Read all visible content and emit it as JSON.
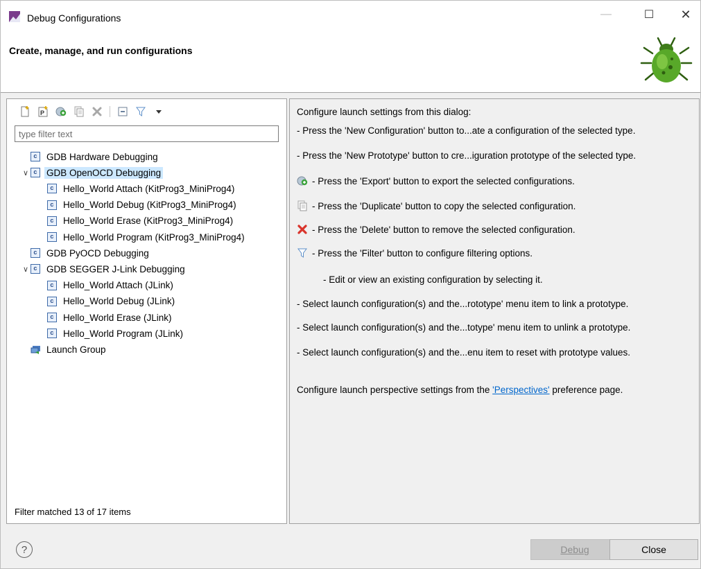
{
  "window": {
    "title": "Debug Configurations",
    "minimize_glyph": "—",
    "maximize_glyph": "☐",
    "close_glyph": "✕"
  },
  "header": {
    "title": "Create, manage, and run configurations"
  },
  "left": {
    "filter_placeholder": "type filter text",
    "status": "Filter matched 13 of 17 items",
    "tree": [
      {
        "label": "GDB Hardware Debugging",
        "icon": "c-config-icon",
        "level": 1,
        "expandable": false
      },
      {
        "label": "GDB OpenOCD Debugging",
        "icon": "c-config-icon",
        "level": 1,
        "expandable": true,
        "expanded": true,
        "selected": true
      },
      {
        "label": "Hello_World Attach (KitProg3_MiniProg4)",
        "icon": "c-config-icon",
        "level": 2
      },
      {
        "label": "Hello_World Debug (KitProg3_MiniProg4)",
        "icon": "c-config-icon",
        "level": 2
      },
      {
        "label": "Hello_World Erase (KitProg3_MiniProg4)",
        "icon": "c-config-icon",
        "level": 2
      },
      {
        "label": "Hello_World Program (KitProg3_MiniProg4)",
        "icon": "c-config-icon",
        "level": 2
      },
      {
        "label": "GDB PyOCD Debugging",
        "icon": "c-config-icon",
        "level": 1,
        "expandable": false
      },
      {
        "label": "GDB SEGGER J-Link Debugging",
        "icon": "c-config-icon",
        "level": 1,
        "expandable": true,
        "expanded": true
      },
      {
        "label": "Hello_World Attach (JLink)",
        "icon": "c-config-icon",
        "level": 2
      },
      {
        "label": "Hello_World Debug (JLink)",
        "icon": "c-config-icon",
        "level": 2
      },
      {
        "label": "Hello_World Erase (JLink)",
        "icon": "c-config-icon",
        "level": 2
      },
      {
        "label": "Hello_World Program (JLink)",
        "icon": "c-config-icon",
        "level": 2
      },
      {
        "label": "Launch Group",
        "icon": "launch-group-icon",
        "level": 1,
        "expandable": false
      }
    ]
  },
  "right": {
    "intro": "Configure launch settings from this dialog:",
    "lines": [
      {
        "text": "- Press the 'New Configuration' button to...ate a configuration of the selected type.",
        "icon": null
      },
      {
        "text": "- Press the 'New Prototype' button to cre...iguration prototype of the selected type.",
        "icon": null
      },
      {
        "text": "- Press the 'Export' button to export the selected configurations.",
        "icon": "export-icon"
      },
      {
        "text": "- Press the 'Duplicate' button to copy the selected configuration.",
        "icon": "duplicate-icon"
      },
      {
        "text": "- Press the 'Delete' button to remove the selected configuration.",
        "icon": "delete-icon"
      },
      {
        "text": "- Press the 'Filter' button to configure filtering options.",
        "icon": "filter-icon"
      },
      {
        "text": "- Edit or view an existing configuration by selecting it.",
        "icon": "blank"
      },
      {
        "text": "- Select launch configuration(s) and the...rototype' menu item to link a prototype.",
        "icon": null
      },
      {
        "text": "- Select launch configuration(s) and the...totype' menu item to unlink a prototype.",
        "icon": null
      },
      {
        "text": "- Select launch configuration(s) and the...enu item to reset with prototype values.",
        "icon": null
      }
    ],
    "persp_prefix": "Configure launch perspective settings from the ",
    "persp_link": "'Perspectives'",
    "persp_suffix": " preference page."
  },
  "footer": {
    "help_glyph": "?",
    "debug_label": "Debug",
    "close_label": "Close"
  }
}
